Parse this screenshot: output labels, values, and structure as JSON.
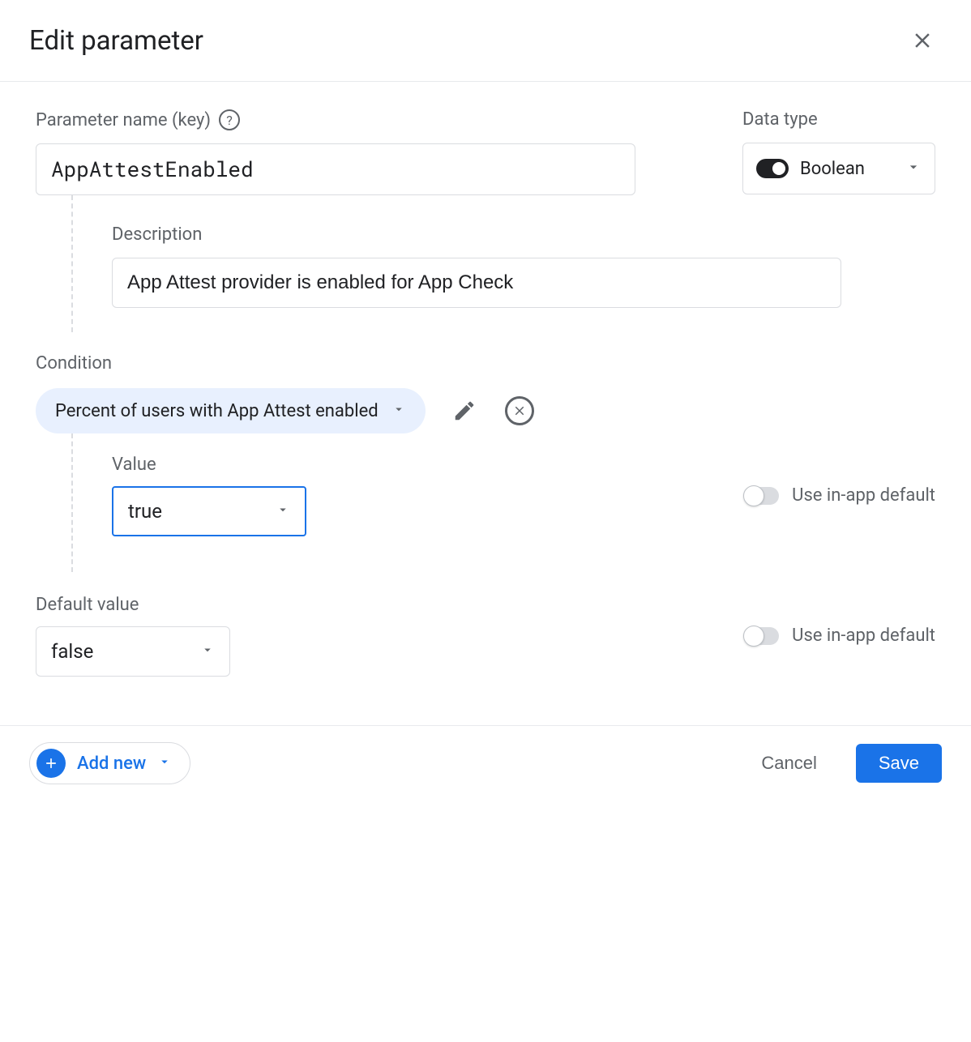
{
  "header": {
    "title": "Edit parameter"
  },
  "param": {
    "name_label": "Parameter name (key)",
    "name_value": "AppAttestEnabled",
    "datatype_label": "Data type",
    "datatype_value": "Boolean"
  },
  "description": {
    "label": "Description",
    "value": "App Attest provider is enabled for App Check"
  },
  "condition": {
    "label": "Condition",
    "chip": "Percent of users with App Attest enabled",
    "value_label": "Value",
    "value": "true",
    "inapp_label": "Use in-app default"
  },
  "default": {
    "label": "Default value",
    "value": "false",
    "inapp_label": "Use in-app default"
  },
  "footer": {
    "add_new": "Add new",
    "cancel": "Cancel",
    "save": "Save"
  }
}
